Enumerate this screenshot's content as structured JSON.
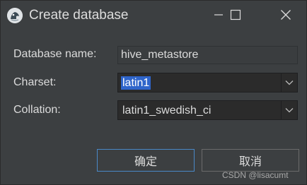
{
  "window": {
    "title": "Create database",
    "icon": "app-icon",
    "controls": {
      "minimize": "minimize-icon",
      "maximize": "maximize-icon",
      "close": "close-icon"
    }
  },
  "form": {
    "database_name": {
      "label": "Database name:",
      "value": "hive_metastore"
    },
    "charset": {
      "label": "Charset:",
      "value": "latin1"
    },
    "collation": {
      "label": "Collation:",
      "value": "latin1_swedish_ci"
    }
  },
  "buttons": {
    "ok": "确定",
    "cancel": "取消"
  },
  "watermark": "CSDN @lisacumt",
  "colors": {
    "background": "#3c3f41",
    "selection": "#2f65ca",
    "focus_border": "#4a88c7"
  }
}
